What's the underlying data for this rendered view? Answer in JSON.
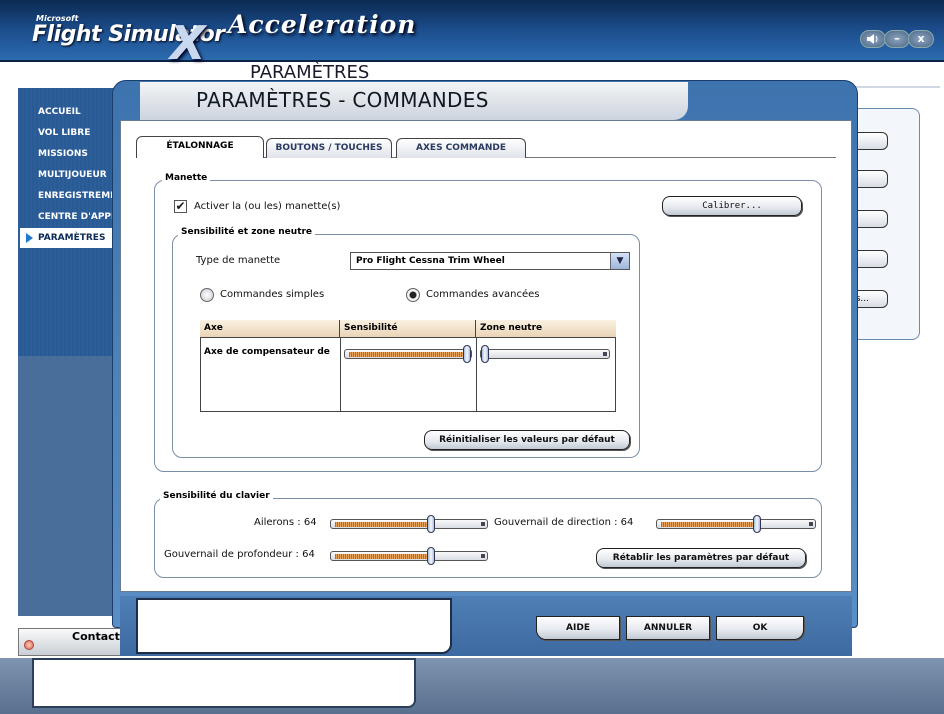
{
  "app": {
    "brand_small": "Microsoft",
    "brand": "Flight Simulator",
    "brand_x": "X",
    "edition": "Acceleration",
    "window_controls": {
      "sound_icon": "speaker-icon",
      "minimize": "–",
      "close": "x"
    }
  },
  "background_page": {
    "title": "PARAMÈTRES",
    "right_button_partial": "rs..."
  },
  "sidebar": {
    "items": [
      {
        "label": "ACCUEIL"
      },
      {
        "label": "VOL LIBRE"
      },
      {
        "label": "MISSIONS"
      },
      {
        "label": "MULTIJOUEUR"
      },
      {
        "label": "ENREGISTREMENT"
      },
      {
        "label": "CENTRE D'APPRENTISSAGE"
      },
      {
        "label": "PARAMÈTRES"
      }
    ],
    "active": "PARAMÈTRES"
  },
  "contacts": {
    "label": "Contacts"
  },
  "dialog": {
    "title": "PARAMÈTRES - COMMANDES",
    "tabs": [
      {
        "label": "ÉTALONNAGE",
        "active": true
      },
      {
        "label": "BOUTONS / TOUCHES",
        "active": false
      },
      {
        "label": "AXES COMMANDE",
        "active": false
      }
    ],
    "joystick_group": {
      "label": "Manette",
      "enable_checkbox": {
        "label": "Activer la (ou les) manette(s)",
        "checked": true
      },
      "calibrate_button": "Calibrer..."
    },
    "sensitivity_group": {
      "label": "Sensibilité et zone neutre",
      "controller_type_label": "Type de manette",
      "controller_type_value": "Pro Flight Cessna Trim Wheel",
      "radio_simple": "Commandes simples",
      "radio_advanced": "Commandes avancées",
      "selected_mode": "advanced",
      "table": {
        "columns": [
          "Axe",
          "Sensibilité",
          "Zone neutre"
        ],
        "rows": [
          {
            "axis": "Axe de compensateur de",
            "sensitivity": 1.0,
            "null_zone": 0.0
          }
        ]
      },
      "reset_button": "Réinitialiser les valeurs par défaut"
    },
    "keyboard_group": {
      "label": "Sensibilité du clavier",
      "ailerons_label": "Ailerons : 64",
      "rudder_label": "Gouvernail de direction : 64",
      "elevator_label": "Gouvernail de profondeur : 64",
      "ailerons_value": 0.64,
      "rudder_value": 0.64,
      "elevator_value": 0.64,
      "restore_button": "Rétablir les paramètres par défaut"
    },
    "footer": {
      "help": "AIDE",
      "cancel": "ANNULER",
      "ok": "OK"
    }
  }
}
